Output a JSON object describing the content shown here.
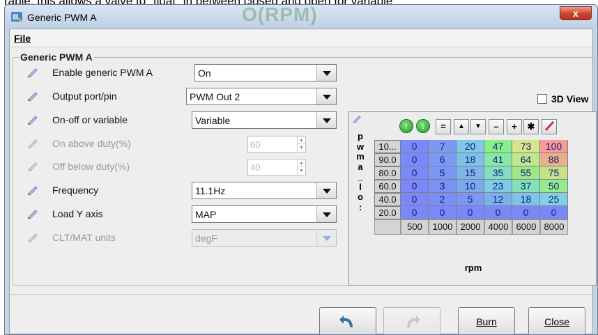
{
  "background_text": "rable; this allows a valve to \"float\" in between closed and open for variable",
  "window": {
    "title": "Generic PWM A",
    "ghost_text": "O(RPM)",
    "close_label": "x"
  },
  "menu": {
    "file_label": "File"
  },
  "group": {
    "title": "Generic PWM A",
    "fields": {
      "enable": {
        "label": "Enable generic PWM A",
        "value": "On"
      },
      "output": {
        "label": "Output port/pin",
        "value": "PWM Out 2"
      },
      "onoff": {
        "label": "On-off or variable",
        "value": "Variable"
      },
      "on_above": {
        "label": "On above duty(%)",
        "value": "60"
      },
      "off_below": {
        "label": "Off below duty(%)",
        "value": "40"
      },
      "frequency": {
        "label": "Frequency",
        "value": "11.1Hz"
      },
      "load_y": {
        "label": "Load Y axis",
        "value": "MAP"
      },
      "clt_units": {
        "label": "CLT/MAT units",
        "value": "degF"
      }
    },
    "view3d_label": "3D View"
  },
  "table": {
    "y_axis_title": [
      "p",
      "w",
      "m",
      "a",
      "_",
      "l",
      "o",
      ":"
    ],
    "x_axis_title": "rpm",
    "toolbar": {
      "up": "↑",
      "down": "↓",
      "equals": "=",
      "inc": "▲",
      "dec": "▼",
      "minus": "–",
      "plus": "+",
      "mult": "✱",
      "pen": "/"
    },
    "row_headers": [
      "10...",
      "90.0",
      "80.0",
      "60.0",
      "40.0",
      "20.0"
    ],
    "col_headers": [
      "500",
      "1000",
      "2000",
      "4000",
      "6000",
      "8000"
    ],
    "cells": [
      [
        "0",
        "7",
        "20",
        "47",
        "73",
        "100"
      ],
      [
        "0",
        "6",
        "18",
        "41",
        "64",
        "88"
      ],
      [
        "0",
        "5",
        "15",
        "35",
        "55",
        "75"
      ],
      [
        "0",
        "3",
        "10",
        "23",
        "37",
        "50"
      ],
      [
        "0",
        "2",
        "5",
        "12",
        "18",
        "25"
      ],
      [
        "0",
        "0",
        "0",
        "0",
        "0",
        "0"
      ]
    ],
    "cell_colors": [
      [
        "#7b89f8",
        "#7b99f2",
        "#7ec8e8",
        "#88ee88",
        "#d5e58a",
        "#f89a9a"
      ],
      [
        "#7b89f8",
        "#7b99f2",
        "#7ec0ea",
        "#88e8a8",
        "#c0e88a",
        "#eab08a"
      ],
      [
        "#7b89f8",
        "#7b96f3",
        "#7eb6ec",
        "#84dcc2",
        "#9ee88a",
        "#c8e08a"
      ],
      [
        "#7b89f8",
        "#7b92f5",
        "#7ca8ee",
        "#7ecce6",
        "#84e2b8",
        "#98ea90"
      ],
      [
        "#7b89f8",
        "#7b8ff6",
        "#7b96f3",
        "#7cb0ec",
        "#7ec4e8",
        "#80d2e2"
      ],
      [
        "#7b89f8",
        "#7b89f8",
        "#7b89f8",
        "#7b89f8",
        "#7b89f8",
        "#7b89f8"
      ]
    ]
  },
  "footer": {
    "undo_icon": "undo-icon",
    "redo_icon": "redo-icon",
    "burn_label": "Burn",
    "close_label": "Close"
  }
}
